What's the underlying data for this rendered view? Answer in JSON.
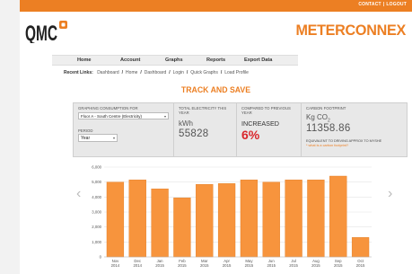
{
  "header": {
    "links": [
      "CONTACT",
      "LOGOUT"
    ],
    "separator": "|",
    "logo_left": "QMC",
    "logo_right": "METERCONNEX",
    "accent_color": "#ec7f23"
  },
  "nav": {
    "items": [
      "Home",
      "Account",
      "Graphs",
      "Reports",
      "Export Data"
    ]
  },
  "recent": {
    "label": "Recent Links:",
    "links": [
      "Dashboard",
      "Home",
      "Dashboard",
      "Login",
      "Quick Graphs",
      "Load Profile"
    ]
  },
  "page_title": "TRACK AND SAVE",
  "panel": {
    "graphing_label": "GRAPHING CONSUMPTION FOR",
    "graphing_value": "Floor A - South Centre (Electricity)",
    "period_label": "PERIOD",
    "period_value": "Year",
    "total_label": "TOTAL ELECTRICITY THIS YEAR",
    "total_unit": "kWh",
    "total_value": "55828",
    "compared_label": "COMPARED TO PREVIOUS YEAR",
    "compared_status": "INCREASED",
    "compared_pct": "6%",
    "carbon_label": "CARBON FOOTPRINT",
    "carbon_unit": "Kg CO",
    "carbon_sub": "2",
    "carbon_value": "11358.86",
    "equiv_label": "EQUIVALENT TO DRIVING APPROX TO MYSHE",
    "equiv_link": "* what is a carbon footprint?"
  },
  "chart_data": {
    "type": "bar",
    "categories": [
      [
        "Nov",
        "2014"
      ],
      [
        "Dec",
        "2014"
      ],
      [
        "Jan",
        "2015"
      ],
      [
        "Feb",
        "2015"
      ],
      [
        "Mar",
        "2015"
      ],
      [
        "Apr",
        "2015"
      ],
      [
        "May",
        "2015"
      ],
      [
        "Jun",
        "2015"
      ],
      [
        "Jul",
        "2015"
      ],
      [
        "Aug",
        "2015"
      ],
      [
        "Sep",
        "2015"
      ],
      [
        "Oct",
        "2015"
      ]
    ],
    "values": [
      5000,
      5150,
      4550,
      3950,
      4850,
      4900,
      5150,
      5000,
      5150,
      5150,
      5400,
      1300
    ],
    "ylim": [
      0,
      6000
    ],
    "yticks": [
      0,
      1000,
      2000,
      3000,
      4000,
      5000,
      6000
    ],
    "ytick_labels": [
      "0",
      "1,000",
      "2,000",
      "3,000",
      "4,000",
      "5,000",
      "6,000"
    ],
    "grid": true,
    "bar_color": "#f7943d",
    "bar_border": "#e07a1f"
  },
  "icons": {
    "prev": "chevron-left-icon",
    "next": "chevron-right-icon",
    "logo_mark": "qmc-logo-mark"
  }
}
